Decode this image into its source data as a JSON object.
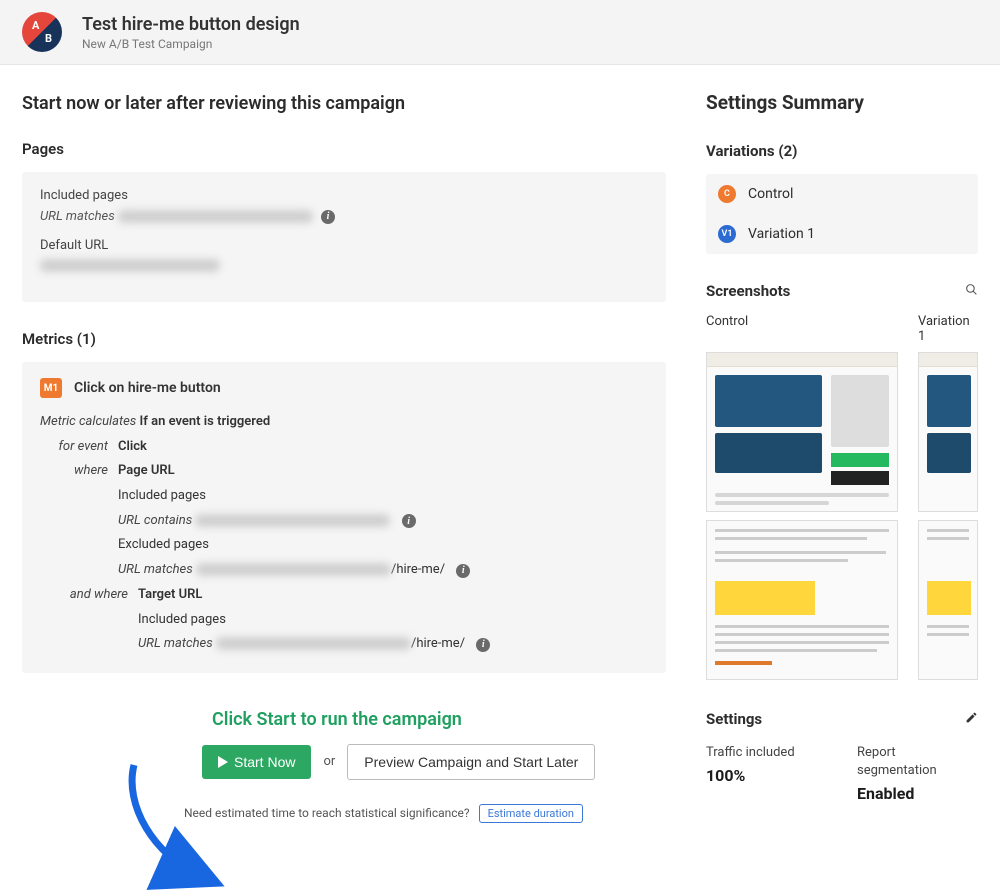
{
  "header": {
    "title": "Test hire-me button design",
    "subtitle": "New A/B Test Campaign"
  },
  "lead": "Start now or later after reviewing this campaign",
  "pages": {
    "title": "Pages",
    "included_label": "Included pages",
    "url_matches_label": "URL matches",
    "default_url_label": "Default URL"
  },
  "metrics": {
    "title": "Metrics (1)",
    "badge": "M1",
    "name": "Click on hire-me button",
    "calc_prefix": "Metric calculates",
    "calc_value": "If an event is triggered",
    "for_event_label": "for event",
    "for_event_value": "Click",
    "where_label": "where",
    "and_where_label": "and where",
    "page_url": "Page URL",
    "target_url": "Target URL",
    "included_pages": "Included pages",
    "excluded_pages": "Excluded pages",
    "url_contains": "URL contains",
    "url_matches": "URL matches",
    "hire_me_suffix": "/hire-me/"
  },
  "annotation": "Click Start to run the campaign",
  "actions": {
    "start": "Start Now",
    "or": "or",
    "preview": "Preview Campaign and Start Later",
    "estimate_prompt": "Need estimated time to reach statistical significance?",
    "estimate_link": "Estimate duration"
  },
  "summary": {
    "title": "Settings Summary",
    "variations_title": "Variations (2)",
    "variations": [
      {
        "badge": "C",
        "cls": "c",
        "label": "Control"
      },
      {
        "badge": "V1",
        "cls": "v",
        "label": "Variation 1"
      }
    ],
    "screenshots_title": "Screenshots",
    "shot_control": "Control",
    "shot_variation": "Variation 1",
    "settings_title": "Settings",
    "traffic_label": "Traffic included",
    "traffic_value": "100%",
    "report_label": "Report segmentation",
    "report_value": "Enabled"
  }
}
